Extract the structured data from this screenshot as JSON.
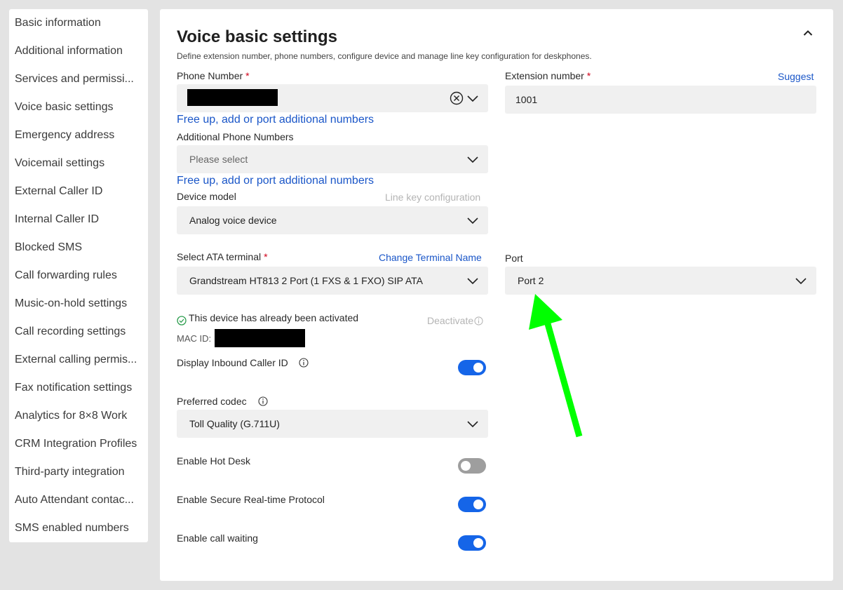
{
  "sidebar": {
    "items": [
      {
        "label": "Basic information"
      },
      {
        "label": "Additional information"
      },
      {
        "label": "Services and permissi..."
      },
      {
        "label": "Voice basic settings"
      },
      {
        "label": "Emergency address"
      },
      {
        "label": "Voicemail settings"
      },
      {
        "label": "External Caller ID"
      },
      {
        "label": "Internal Caller ID"
      },
      {
        "label": "Blocked SMS"
      },
      {
        "label": "Call forwarding rules"
      },
      {
        "label": "Music-on-hold settings"
      },
      {
        "label": "Call recording settings"
      },
      {
        "label": "External calling permis..."
      },
      {
        "label": "Fax notification settings"
      },
      {
        "label": "Analytics for 8×8 Work"
      },
      {
        "label": "CRM Integration Profiles"
      },
      {
        "label": "Third-party integration"
      },
      {
        "label": "Auto Attendant contac..."
      },
      {
        "label": "SMS enabled numbers"
      }
    ]
  },
  "section": {
    "title": "Voice basic settings",
    "subtitle": "Define extension number, phone numbers, configure device and manage line key configuration for deskphones.",
    "collapse_icon": "chevron-up-icon"
  },
  "phone_number": {
    "label": "Phone Number",
    "required_mark": "*",
    "link": "Free up, add or port additional numbers"
  },
  "extension": {
    "label": "Extension number",
    "required_mark": "*",
    "suggest": "Suggest",
    "value": "1001"
  },
  "additional_numbers": {
    "label": "Additional Phone Numbers",
    "placeholder": "Please select",
    "link": "Free up, add or port additional numbers"
  },
  "device_model": {
    "label": "Device model",
    "line_key_link": "Line key configuration",
    "value": "Analog voice device"
  },
  "ata_terminal": {
    "label": "Select ATA terminal",
    "required_mark": "*",
    "change_link": "Change Terminal Name",
    "value": "Grandstream HT813 2 Port (1 FXS & 1 FXO) SIP ATA"
  },
  "port": {
    "label": "Port",
    "value": "Port 2"
  },
  "activation": {
    "status": "This device has already been activated",
    "deactivate": "Deactivate",
    "mac_label": "MAC ID:"
  },
  "toggles": {
    "inbound_caller_id": {
      "label": "Display Inbound Caller ID",
      "on": true
    },
    "hot_desk": {
      "label": "Enable Hot Desk",
      "on": false
    },
    "srtp": {
      "label": "Enable Secure Real-time Protocol",
      "on": true
    },
    "call_waiting": {
      "label": "Enable call waiting",
      "on": true
    }
  },
  "codec": {
    "label": "Preferred codec",
    "value": "Toll Quality (G.711U)"
  },
  "colors": {
    "accent": "#1565e8",
    "link": "#1a56c8",
    "required": "#d0021b",
    "annotation_arrow": "#00ff00",
    "toggle_off": "#9e9e9e"
  }
}
